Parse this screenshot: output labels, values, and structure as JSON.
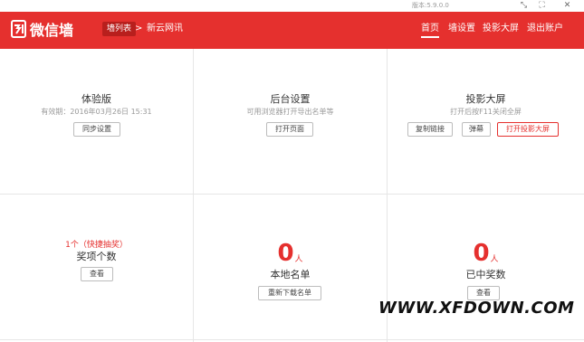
{
  "window": {
    "version": "版本:5.9.0.0"
  },
  "header": {
    "logo_text": "微信墙",
    "crumb_pill": "墙列表",
    "crumb_sep": ">",
    "crumb_current": "新云网讯",
    "nav": [
      "首页",
      "墙设置",
      "投影大屏",
      "退出账户"
    ]
  },
  "cards": {
    "trial": {
      "title": "体验版",
      "validity": "有效期：2016年03月26日 15:31",
      "button": "同步设置"
    },
    "backend": {
      "title": "后台设置",
      "desc": "可用浏览器打开导出名单等",
      "button": "打开页面"
    },
    "projection": {
      "title": "投影大屏",
      "desc": "打开后按F11关闭全屏",
      "buttons": [
        "复制链接",
        "弹幕",
        "打开投影大屏"
      ]
    },
    "prizes": {
      "count_text": "1个（快捷抽奖）",
      "title": "奖项个数",
      "button": "查看"
    },
    "local_list": {
      "number": "0",
      "unit": "人",
      "title": "本地名单",
      "button": "重新下载名单"
    },
    "winners": {
      "number": "0",
      "unit": "人",
      "title": "已中奖数",
      "button": "查看"
    }
  },
  "watermark": "WWW.XFDOWN.COM",
  "colors": {
    "brand_red": "#e5302e",
    "crumb_dark_red": "#b81f1d"
  }
}
